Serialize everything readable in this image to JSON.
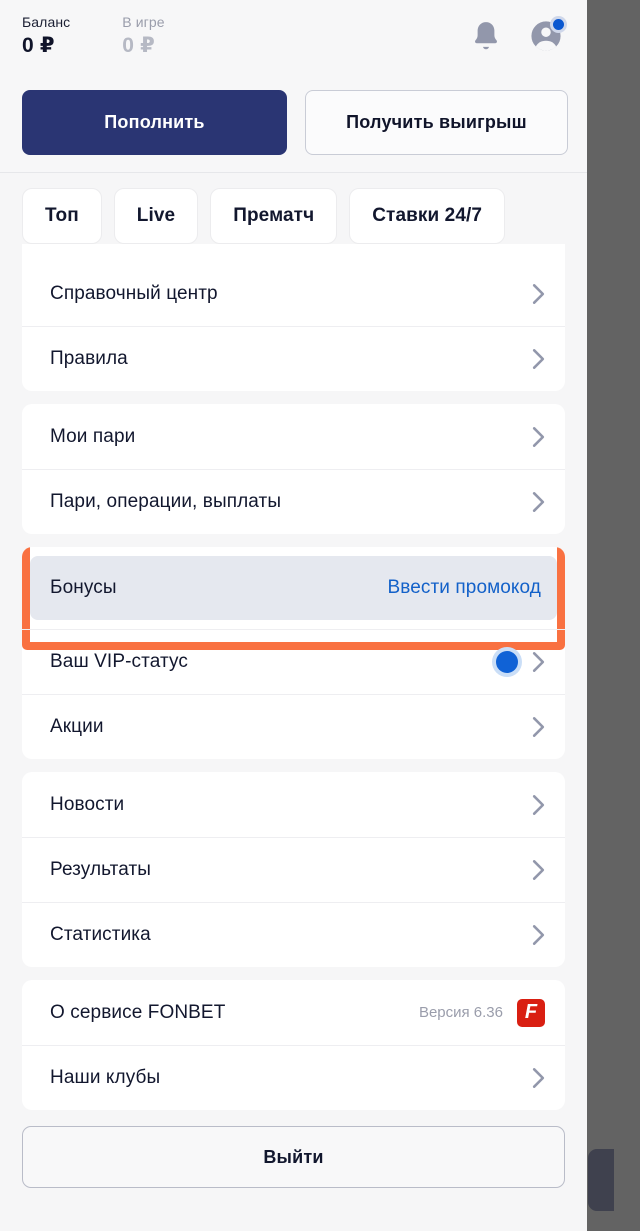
{
  "header": {
    "balance_label": "Баланс",
    "balance_value": "0 ₽",
    "inplay_label": "В игре",
    "inplay_value": "0 ₽",
    "deposit_button": "Пополнить",
    "withdraw_button": "Получить выигрыш",
    "bell_icon": "bell-icon",
    "avatar_icon": "avatar-icon"
  },
  "tabs": [
    {
      "label": "Топ"
    },
    {
      "label": "Live"
    },
    {
      "label": "Прематч"
    },
    {
      "label": "Ставки 24/7"
    }
  ],
  "menu": {
    "group1": [
      {
        "label": "Справочный центр",
        "chevron": true
      },
      {
        "label": "Правила",
        "chevron": true
      }
    ],
    "group2": [
      {
        "label": "Мои пари",
        "chevron": true
      },
      {
        "label": "Пари, операции, выплаты",
        "chevron": true
      }
    ],
    "group3": [
      {
        "label": "Бонусы",
        "action": "Ввести промокод",
        "highlighted": true
      },
      {
        "label": "Ваш VIP-статус",
        "chevron": true,
        "dot": true
      },
      {
        "label": "Акции",
        "chevron": true
      }
    ],
    "group4": [
      {
        "label": "Новости",
        "chevron": true
      },
      {
        "label": "Результаты",
        "chevron": true
      },
      {
        "label": "Статистика",
        "chevron": true
      }
    ],
    "group5": [
      {
        "label": "О сервисе FONBET",
        "meta": "Версия 6.36",
        "logo": "fonbet-logo"
      },
      {
        "label": "Наши клубы",
        "chevron": true
      }
    ]
  },
  "logout_button": "Выйти",
  "colors": {
    "primary": "#2a3573",
    "accent_link": "#1361c9",
    "highlight": "#f97141",
    "brand_red": "#d91f12",
    "vip_dot": "#1062d6",
    "page_bg": "#f6f6f7",
    "card_bg": "#ffffff",
    "promo_bg": "#e5e8ef",
    "overlay": "#636363"
  }
}
